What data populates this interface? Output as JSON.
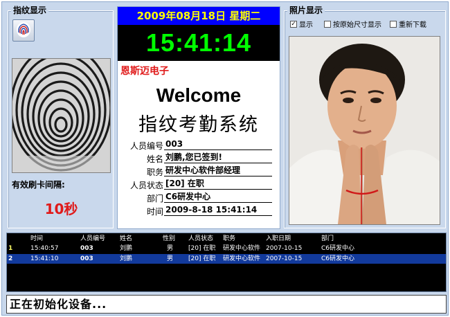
{
  "fingerprint_panel": {
    "title": "指纹显示",
    "button_icon": "fingerprint-icon",
    "interval_label": "有效刷卡间隔:",
    "interval_value": "10秒"
  },
  "center": {
    "date": "2009年08月18日 星期二",
    "time": "15:41:14",
    "company": "恩斯迈电子",
    "welcome": "Welcome",
    "system_title": "指纹考勤系统",
    "fields": [
      {
        "label": "人员编号",
        "value": "003"
      },
      {
        "label": "姓名",
        "value": "刘鹏,您已签到!"
      },
      {
        "label": "职务",
        "value": "研发中心软件部经理"
      },
      {
        "label": "人员状态",
        "value": "[20] 在职"
      },
      {
        "label": "部门",
        "value": "C6研发中心"
      },
      {
        "label": "时间",
        "value": "2009-8-18 15:41:14"
      }
    ]
  },
  "photo_panel": {
    "title": "照片显示",
    "options": [
      {
        "label": "显示",
        "checked": true
      },
      {
        "label": "按原始尺寸显示",
        "checked": false
      },
      {
        "label": "重新下载",
        "checked": false
      }
    ]
  },
  "records": {
    "columns": [
      "时间",
      "人员编号",
      "姓名",
      "性别",
      "人员状态",
      "职务",
      "入职日期",
      "部门"
    ],
    "rows": [
      {
        "num": "1",
        "time": "15:40:57",
        "id": "003",
        "name": "刘鹏",
        "gender": "男",
        "status": "[20] 在职",
        "position": "研发中心软件",
        "join_date": "2007-10-15",
        "dept": "C6研发中心"
      },
      {
        "num": "2",
        "time": "15:41:10",
        "id": "003",
        "name": "刘鹏",
        "gender": "男",
        "status": "[20] 在职",
        "position": "研发中心软件",
        "join_date": "2007-10-15",
        "dept": "C6研发中心"
      }
    ]
  },
  "status_bar": {
    "text": "正在初始化设备..."
  },
  "colors": {
    "window_bg": "#c9d8ec",
    "date_bar_bg": "#0000ff",
    "date_text": "#ffff00",
    "clock_bg": "#000000",
    "clock_text": "#00ff00",
    "accent_red": "#e01a1a",
    "selected_row": "#123a9c"
  }
}
